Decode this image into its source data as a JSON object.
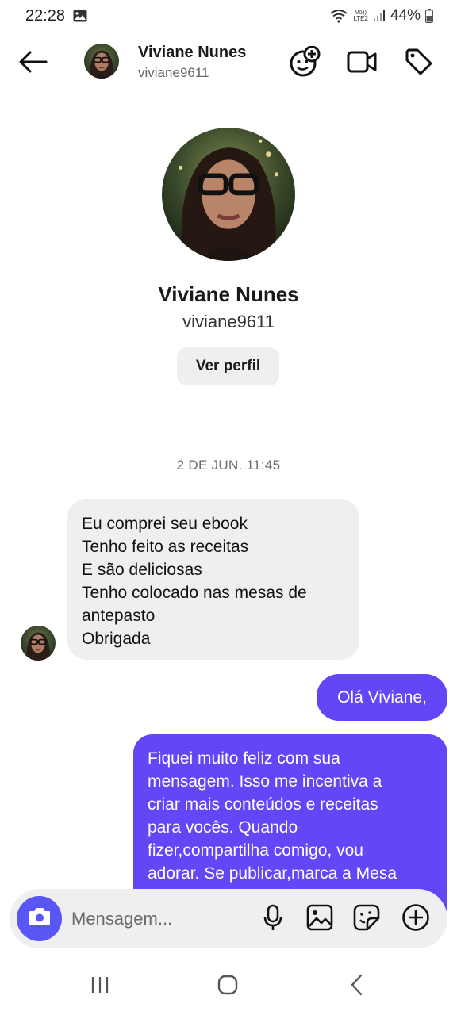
{
  "status_bar": {
    "time": "22:28",
    "network_top": "Vo))",
    "network_bottom": "LTE2",
    "battery": "44%"
  },
  "header": {
    "name": "Viviane Nunes",
    "username": "viviane9611"
  },
  "profile": {
    "name": "Viviane Nunes",
    "username": "viviane9611",
    "view_profile_label": "Ver perfil"
  },
  "timestamp": "2 DE JUN. 11:45",
  "messages": {
    "incoming": {
      "lines": [
        "Eu comprei seu ebook",
        "Tenho feito as receitas",
        "E são deliciosas",
        "Tenho colocado nas mesas de",
        "antepasto",
        "Obrigada"
      ]
    },
    "outgoing_1": "Olá Viviane,",
    "outgoing_2": {
      "lines": [
        "Fiquei muito feliz com sua",
        "mensagem. Isso me incentiva a",
        "criar mais conteúdos e receitas",
        "para vocês.  Quando",
        "fizer,compartilha comigo, vou",
        "adorar. Se publicar,marca a Mesa"
      ]
    }
  },
  "composer": {
    "placeholder": "Mensagem..."
  },
  "icons": {
    "back": "arrow-left-icon",
    "add_people": "add-friends-icon",
    "video": "video-call-icon",
    "tag": "tag-icon",
    "camera": "camera-icon",
    "mic": "microphone-icon",
    "gallery": "image-icon",
    "sticker": "sticker-icon",
    "more": "plus-circle-icon"
  },
  "colors": {
    "outgoing_bubble": "#6147f5",
    "incoming_bubble": "#efeff1",
    "camera_button": "#5a55f5"
  }
}
